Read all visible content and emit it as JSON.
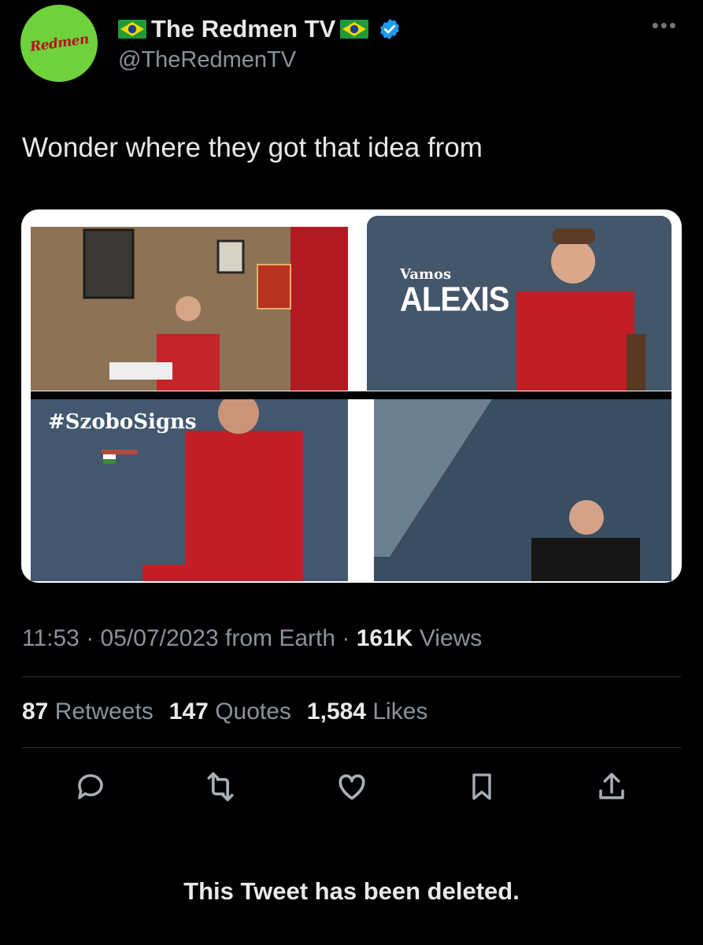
{
  "author": {
    "avatar_text": "Redmen",
    "display_name": "The Redmen TV",
    "handle": "@TheRedmenTV",
    "verified": true
  },
  "tweet": {
    "text": "Wonder where they got that idea from",
    "time": "11:53",
    "date": "05/07/2023",
    "source": "from Earth",
    "views_count": "161K",
    "views_label": "Views"
  },
  "media": {
    "alexis_tag_small": "Vamos",
    "alexis_tag_large": "ALEXIS",
    "szobo_tag": "#SzoboSigns"
  },
  "stats": {
    "retweets_count": "87",
    "retweets_label": "Retweets",
    "quotes_count": "147",
    "quotes_label": "Quotes",
    "likes_count": "1,584",
    "likes_label": "Likes"
  },
  "actions": [
    "reply-icon",
    "retweet-icon",
    "like-icon",
    "bookmark-icon",
    "share-icon"
  ],
  "quoted": {
    "deleted_notice": "This Tweet has been deleted."
  },
  "colors": {
    "background": "#000000",
    "verified": "#1d9bf0",
    "avatar_bg": "#6fd13c",
    "muted_text": "#8b9299"
  }
}
